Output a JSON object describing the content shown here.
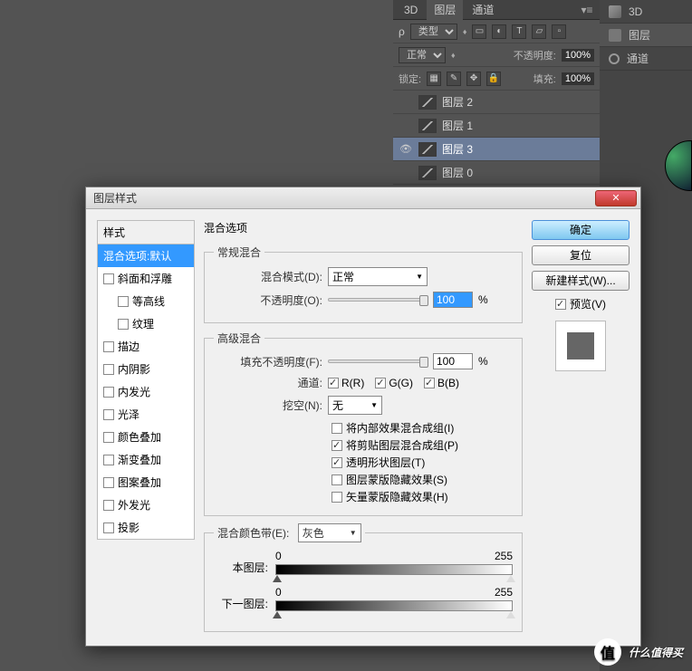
{
  "panel": {
    "tabs": [
      "3D",
      "图层",
      "通道"
    ],
    "active_tab": "图层",
    "type_label": "类型",
    "blend_mode": "正常",
    "opacity_label": "不透明度:",
    "opacity_value": "100%",
    "lock_label": "锁定:",
    "fill_label": "填充:",
    "fill_value": "100%",
    "layers": [
      {
        "visible": false,
        "name": "图层 2"
      },
      {
        "visible": false,
        "name": "图层 1"
      },
      {
        "visible": true,
        "name": "图层 3",
        "selected": true
      },
      {
        "visible": false,
        "name": "图层 0"
      }
    ]
  },
  "side_tabs": [
    "3D",
    "图层",
    "通道"
  ],
  "dialog": {
    "title": "图层样式",
    "styles_header": "样式",
    "styles": [
      {
        "label": "混合选项:默认",
        "selected": true,
        "checkbox": false
      },
      {
        "label": "斜面和浮雕",
        "checkbox": true
      },
      {
        "label": "等高线",
        "checkbox": true,
        "indent": true
      },
      {
        "label": "纹理",
        "checkbox": true,
        "indent": true
      },
      {
        "label": "描边",
        "checkbox": true
      },
      {
        "label": "内阴影",
        "checkbox": true
      },
      {
        "label": "内发光",
        "checkbox": true
      },
      {
        "label": "光泽",
        "checkbox": true
      },
      {
        "label": "颜色叠加",
        "checkbox": true
      },
      {
        "label": "渐变叠加",
        "checkbox": true
      },
      {
        "label": "图案叠加",
        "checkbox": true
      },
      {
        "label": "外发光",
        "checkbox": true
      },
      {
        "label": "投影",
        "checkbox": true
      }
    ],
    "section_title": "混合选项",
    "general": {
      "legend": "常规混合",
      "blend_mode_label": "混合模式(D):",
      "blend_mode_value": "正常",
      "opacity_label": "不透明度(O):",
      "opacity_value": "100",
      "percent": "%"
    },
    "advanced": {
      "legend": "高级混合",
      "fill_opacity_label": "填充不透明度(F):",
      "fill_opacity_value": "100",
      "percent": "%",
      "channels_label": "通道:",
      "channels": [
        {
          "label": "R(R)",
          "checked": true
        },
        {
          "label": "G(G)",
          "checked": true
        },
        {
          "label": "B(B)",
          "checked": true
        }
      ],
      "knockout_label": "挖空(N):",
      "knockout_value": "无",
      "opts": [
        {
          "label": "将内部效果混合成组(I)",
          "checked": false
        },
        {
          "label": "将剪贴图层混合成组(P)",
          "checked": true
        },
        {
          "label": "透明形状图层(T)",
          "checked": true
        },
        {
          "label": "图层蒙版隐藏效果(S)",
          "checked": false
        },
        {
          "label": "矢量蒙版隐藏效果(H)",
          "checked": false
        }
      ]
    },
    "blendif": {
      "legend": "混合颜色带(E):",
      "channel": "灰色",
      "this_layer_label": "本图层:",
      "this_lo": "0",
      "this_hi": "255",
      "under_layer_label": "下一图层:",
      "under_lo": "0",
      "under_hi": "255"
    },
    "buttons": {
      "ok": "确定",
      "cancel": "复位",
      "new_style": "新建样式(W)...",
      "preview": "预览(V)"
    }
  },
  "watermark": {
    "badge": "值",
    "text": "什么值得买"
  }
}
